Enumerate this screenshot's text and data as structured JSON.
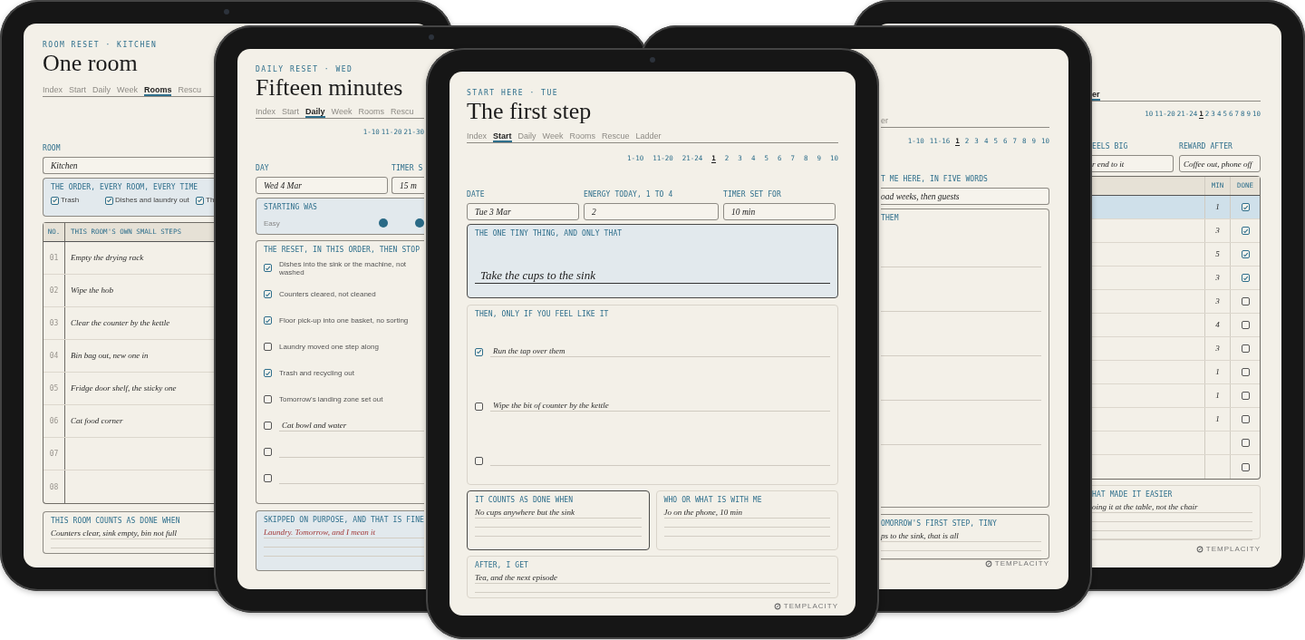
{
  "room_reset": {
    "eyebrow": "ROOM RESET · KITCHEN",
    "title": "One room",
    "tabs": [
      {
        "label": "Index",
        "selected": false
      },
      {
        "label": "Start",
        "selected": false
      },
      {
        "label": "Daily",
        "selected": false
      },
      {
        "label": "Week",
        "selected": false
      },
      {
        "label": "Rooms",
        "selected": true
      },
      {
        "label": "Rescu",
        "selected": false
      }
    ],
    "room": {
      "label": "ROOM",
      "value": "Kitchen"
    },
    "order": {
      "heading": "THE ORDER, EVERY ROOM, EVERY TIME",
      "items": [
        {
          "label": "Trash",
          "checked": true
        },
        {
          "label": "Dishes and laundry out",
          "checked": true
        },
        {
          "label": "Th",
          "checked": true
        }
      ]
    },
    "steps": {
      "columns": [
        "NO.",
        "THIS ROOM'S OWN SMALL STEPS"
      ],
      "rows": [
        {
          "number": "01",
          "step": "Empty the drying rack"
        },
        {
          "number": "02",
          "step": "Wipe the hob"
        },
        {
          "number": "03",
          "step": "Clear the counter by the kettle"
        },
        {
          "number": "04",
          "step": "Bin bag out, new one in"
        },
        {
          "number": "05",
          "step": "Fridge door shelf, the sticky one"
        },
        {
          "number": "06",
          "step": "Cat food corner"
        },
        {
          "number": "07"
        },
        {
          "number": "08"
        }
      ]
    },
    "done_when": {
      "heading": "THIS ROOM COUNTS AS DONE WHEN",
      "lines": [
        "Counters clear, sink empty, bin not full"
      ]
    }
  },
  "daily_reset": {
    "eyebrow": "DAILY RESET · WED",
    "title": "Fifteen minutes",
    "tabs": [
      {
        "label": "Index",
        "selected": false
      },
      {
        "label": "Start",
        "selected": false
      },
      {
        "label": "Daily",
        "selected": true
      },
      {
        "label": "Week",
        "selected": false
      },
      {
        "label": "Rooms",
        "selected": false
      },
      {
        "label": "Rescu",
        "selected": false
      }
    ],
    "pager": [
      {
        "label": "1-10",
        "selected": false
      },
      {
        "label": "11-20",
        "selected": false
      },
      {
        "label": "21-30",
        "selected": false
      }
    ],
    "fields": [
      {
        "label": "DAY",
        "value": "Wed 4 Mar"
      },
      {
        "label": "TIMER S",
        "value": "15 m"
      }
    ],
    "starting": {
      "heading": "STARTING WAS",
      "scale_label": "Easy"
    },
    "reset": {
      "heading": "THE RESET, IN THIS ORDER, THEN STOP",
      "items": [
        {
          "kind": "printed",
          "text": "Dishes into the sink or the machine, not washed",
          "checked": true
        },
        {
          "kind": "printed",
          "text": "Counters cleared, not cleaned",
          "checked": true
        },
        {
          "kind": "printed",
          "text": "Floor pick-up into one basket, no sorting",
          "checked": true
        },
        {
          "kind": "printed",
          "text": "Laundry moved one step along",
          "checked": false
        },
        {
          "kind": "printed",
          "text": "Trash and recycling out",
          "checked": true
        },
        {
          "kind": "printed",
          "text": "Tomorrow's landing zone set out",
          "checked": false
        },
        {
          "kind": "written",
          "text": "Cat bowl and water",
          "checked": false
        },
        {
          "kind": "written",
          "checked": false
        },
        {
          "kind": "written",
          "checked": false
        }
      ]
    },
    "skipped": {
      "heading": "SKIPPED ON PURPOSE, AND THAT IS FINE",
      "lines": [
        "Laundry. Tomorrow, and I mean it"
      ]
    }
  },
  "start_here": {
    "eyebrow": "START HERE · TUE",
    "title": "The first step",
    "tabs": [
      {
        "label": "Index",
        "selected": false
      },
      {
        "label": "Start",
        "selected": true
      },
      {
        "label": "Daily",
        "selected": false
      },
      {
        "label": "Week",
        "selected": false
      },
      {
        "label": "Rooms",
        "selected": false
      },
      {
        "label": "Rescue",
        "selected": false
      },
      {
        "label": "Ladder",
        "selected": false
      }
    ],
    "pager": [
      {
        "label": "1-10",
        "selected": false
      },
      {
        "label": "11-20",
        "selected": false
      },
      {
        "label": "21-24",
        "selected": false
      },
      {
        "label": "1",
        "selected": true
      },
      {
        "label": "2",
        "selected": false
      },
      {
        "label": "3",
        "selected": false
      },
      {
        "label": "4",
        "selected": false
      },
      {
        "label": "5",
        "selected": false
      },
      {
        "label": "6",
        "selected": false
      },
      {
        "label": "7",
        "selected": false
      },
      {
        "label": "8",
        "selected": false
      },
      {
        "label": "9",
        "selected": false
      },
      {
        "label": "10",
        "selected": false
      }
    ],
    "fields": [
      {
        "label": "DATE",
        "value": "Tue 3 Mar"
      },
      {
        "label": "ENERGY TODAY, 1 TO 4",
        "value": "2"
      },
      {
        "label": "TIMER SET FOR",
        "value": "10 min"
      }
    ],
    "tiny_thing": {
      "heading": "THE ONE TINY THING, AND ONLY THAT",
      "value": "Take the cups to the sink"
    },
    "optional": {
      "heading": "THEN, ONLY IF YOU FEEL LIKE IT",
      "items": [
        {
          "text": "Run the tap over them",
          "checked": true
        },
        {
          "text": "Wipe the bit of counter by the kettle",
          "checked": false
        },
        {
          "checked": false
        }
      ]
    },
    "counts_as_done": {
      "heading": "IT COUNTS AS DONE WHEN",
      "lines": [
        "No cups anywhere but the sink"
      ]
    },
    "with_me": {
      "heading": "WHO OR WHAT IS WITH ME",
      "lines": [
        "Jo on the phone, 10 min"
      ]
    },
    "after": {
      "heading": "AFTER, I GET",
      "lines": [
        "Tea, and the next episode"
      ]
    },
    "footer": "TEMPLACITY"
  },
  "right_middle_page": {
    "tabs": [
      {
        "label": "er",
        "selected": false
      }
    ],
    "pager": [
      {
        "label": "1-10",
        "selected": false
      },
      {
        "label": "11-16",
        "selected": false
      },
      {
        "label": "1",
        "selected": true
      },
      {
        "label": "2",
        "selected": false
      },
      {
        "label": "3",
        "selected": false
      },
      {
        "label": "4",
        "selected": false
      },
      {
        "label": "5",
        "selected": false
      },
      {
        "label": "6",
        "selected": false
      },
      {
        "label": "7",
        "selected": false
      },
      {
        "label": "8",
        "selected": false
      },
      {
        "label": "9",
        "selected": false
      },
      {
        "label": "10",
        "selected": false
      }
    ],
    "prompt": {
      "label": "T ME HERE, IN FIVE WORDS",
      "value": "oad weeks, then guests"
    },
    "them": {
      "heading": "THEM"
    },
    "tomorrow": {
      "heading": "OMORROW'S FIRST STEP, TINY",
      "lines": [
        "ps to the sink, that is all"
      ]
    },
    "footer": "TEMPLACITY"
  },
  "right_back_page": {
    "tabs": [
      {
        "label": "er",
        "selected": true
      }
    ],
    "pager": [
      {
        "label": "10",
        "selected": false
      },
      {
        "label": "11-20",
        "selected": false
      },
      {
        "label": "21-24",
        "selected": false
      },
      {
        "label": "1",
        "selected": true
      },
      {
        "label": "2",
        "selected": false
      },
      {
        "label": "3",
        "selected": false
      },
      {
        "label": "4",
        "selected": false
      },
      {
        "label": "5",
        "selected": false
      },
      {
        "label": "6",
        "selected": false
      },
      {
        "label": "7",
        "selected": false
      },
      {
        "label": "8",
        "selected": false
      },
      {
        "label": "9",
        "selected": false
      },
      {
        "label": "10",
        "selected": false
      }
    ],
    "fields": [
      {
        "label": "EELS BIG",
        "value": "r end to it"
      },
      {
        "label": "REWARD AFTER",
        "value": "Coffee out, phone off"
      }
    ],
    "ladder": {
      "columns": [
        "MIN",
        "DONE"
      ],
      "rows": [
        {
          "minutes": "1",
          "done": true,
          "selected": true
        },
        {
          "minutes": "3",
          "done": true,
          "selected": false
        },
        {
          "minutes": "5",
          "done": true,
          "selected": false
        },
        {
          "minutes": "3",
          "done": true,
          "selected": false
        },
        {
          "minutes": "3",
          "done": false,
          "selected": false
        },
        {
          "minutes": "4",
          "done": false,
          "selected": false
        },
        {
          "minutes": "3",
          "done": false,
          "selected": false
        },
        {
          "minutes": "1",
          "done": false,
          "selected": false
        },
        {
          "minutes": "1",
          "done": false,
          "selected": false
        },
        {
          "minutes": "1",
          "done": false,
          "selected": false
        },
        {
          "done": false,
          "selected": false
        },
        {
          "done": false,
          "selected": false
        }
      ]
    },
    "easier": {
      "heading": "HAT MADE IT EASIER",
      "lines": [
        "oing it at the table, not the chair"
      ]
    },
    "footer": "TEMPLACITY"
  }
}
